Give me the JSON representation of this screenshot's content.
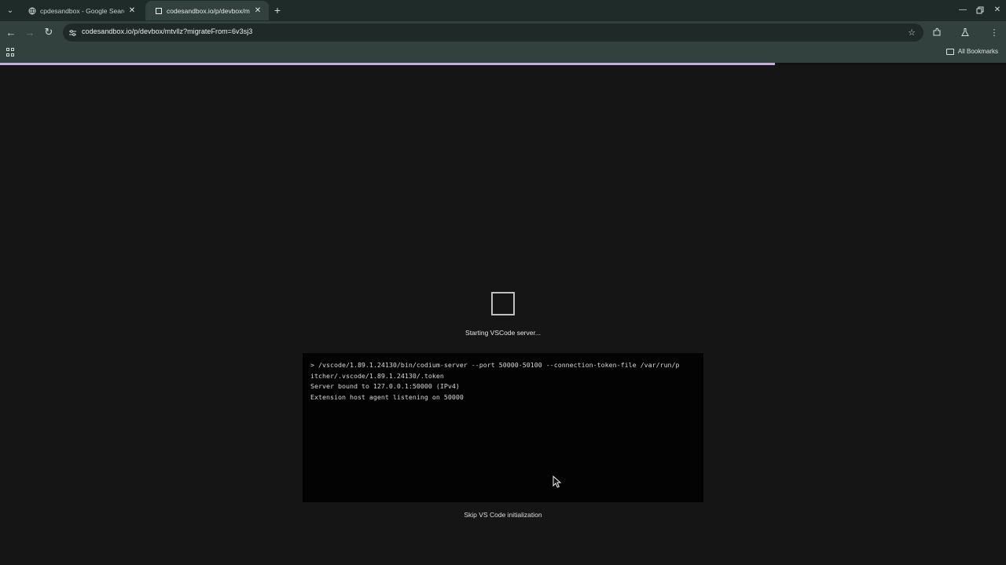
{
  "browser": {
    "tabs": [
      {
        "title": "cpdesandbox - Google Search",
        "active": false
      },
      {
        "title": "codesandbox.io/p/devbox/mtvllz",
        "active": true
      }
    ],
    "address": "codesandbox.io/p/devbox/mtvllz?migrateFrom=6v3sj3",
    "bookmarks_label": "All Bookmarks",
    "new_tab_glyph": "+"
  },
  "page": {
    "loading_fraction": 0.77,
    "status_text": "Starting VSCode server...",
    "terminal": {
      "lines": [
        "> /vscode/1.89.1.24130/bin/codium-server --port 50000-50100 --connection-token-file /var/run/p",
        "itcher/.vscode/1.89.1.24130/.token",
        "Server bound to 127.0.0.1:50000 (IPv4)",
        "Extension host agent listening on 50000"
      ]
    },
    "skip_link": "Skip VS Code initialization"
  }
}
